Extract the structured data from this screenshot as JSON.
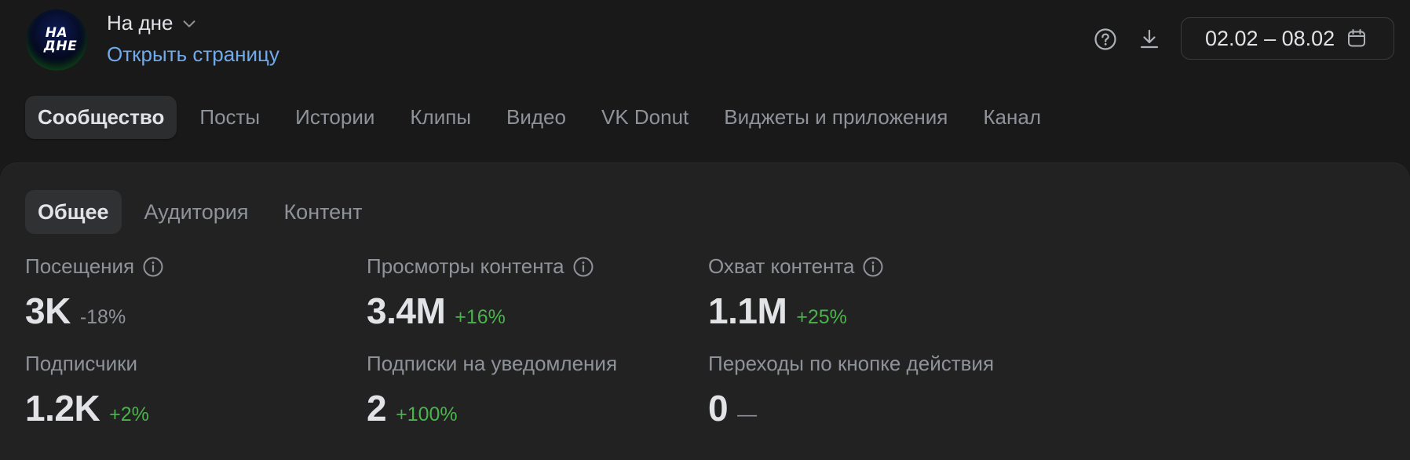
{
  "header": {
    "avatar_text_line1": "НА",
    "avatar_text_line2": "ДНЕ",
    "group_name": "На дне",
    "open_page_link": "Открыть страницу",
    "date_range": "02.02 – 08.02",
    "icons": {
      "help": "help-circle-icon",
      "download": "download-icon",
      "calendar": "calendar-icon",
      "chevron": "chevron-down-icon"
    }
  },
  "top_tabs": [
    {
      "label": "Сообщество",
      "active": true
    },
    {
      "label": "Посты",
      "active": false
    },
    {
      "label": "Истории",
      "active": false
    },
    {
      "label": "Клипы",
      "active": false
    },
    {
      "label": "Видео",
      "active": false
    },
    {
      "label": "VK Donut",
      "active": false
    },
    {
      "label": "Виджеты и приложения",
      "active": false
    },
    {
      "label": "Канал",
      "active": false
    }
  ],
  "sub_tabs": [
    {
      "label": "Общее",
      "active": true
    },
    {
      "label": "Аудитория",
      "active": false
    },
    {
      "label": "Контент",
      "active": false
    }
  ],
  "metrics": [
    {
      "label": "Посещения",
      "value": "3K",
      "delta": "-18%",
      "trend": "negative",
      "info": true
    },
    {
      "label": "Просмотры контента",
      "value": "3.4M",
      "delta": "+16%",
      "trend": "positive",
      "info": true
    },
    {
      "label": "Охват контента",
      "value": "1.1M",
      "delta": "+25%",
      "trend": "positive",
      "info": true
    },
    {
      "label": "Подписчики",
      "value": "1.2K",
      "delta": "+2%",
      "trend": "positive",
      "info": false
    },
    {
      "label": "Подписки на уведомления",
      "value": "2",
      "delta": "+100%",
      "trend": "positive",
      "info": false
    },
    {
      "label": "Переходы по кнопке действия",
      "value": "0",
      "delta": "—",
      "trend": "neutral",
      "info": false
    }
  ],
  "colors": {
    "background": "#19191a",
    "card": "#222223",
    "link": "#71aaeb",
    "positive": "#4bb34b",
    "secondary_text": "#8f9399",
    "primary_text": "#e1e3e6"
  }
}
